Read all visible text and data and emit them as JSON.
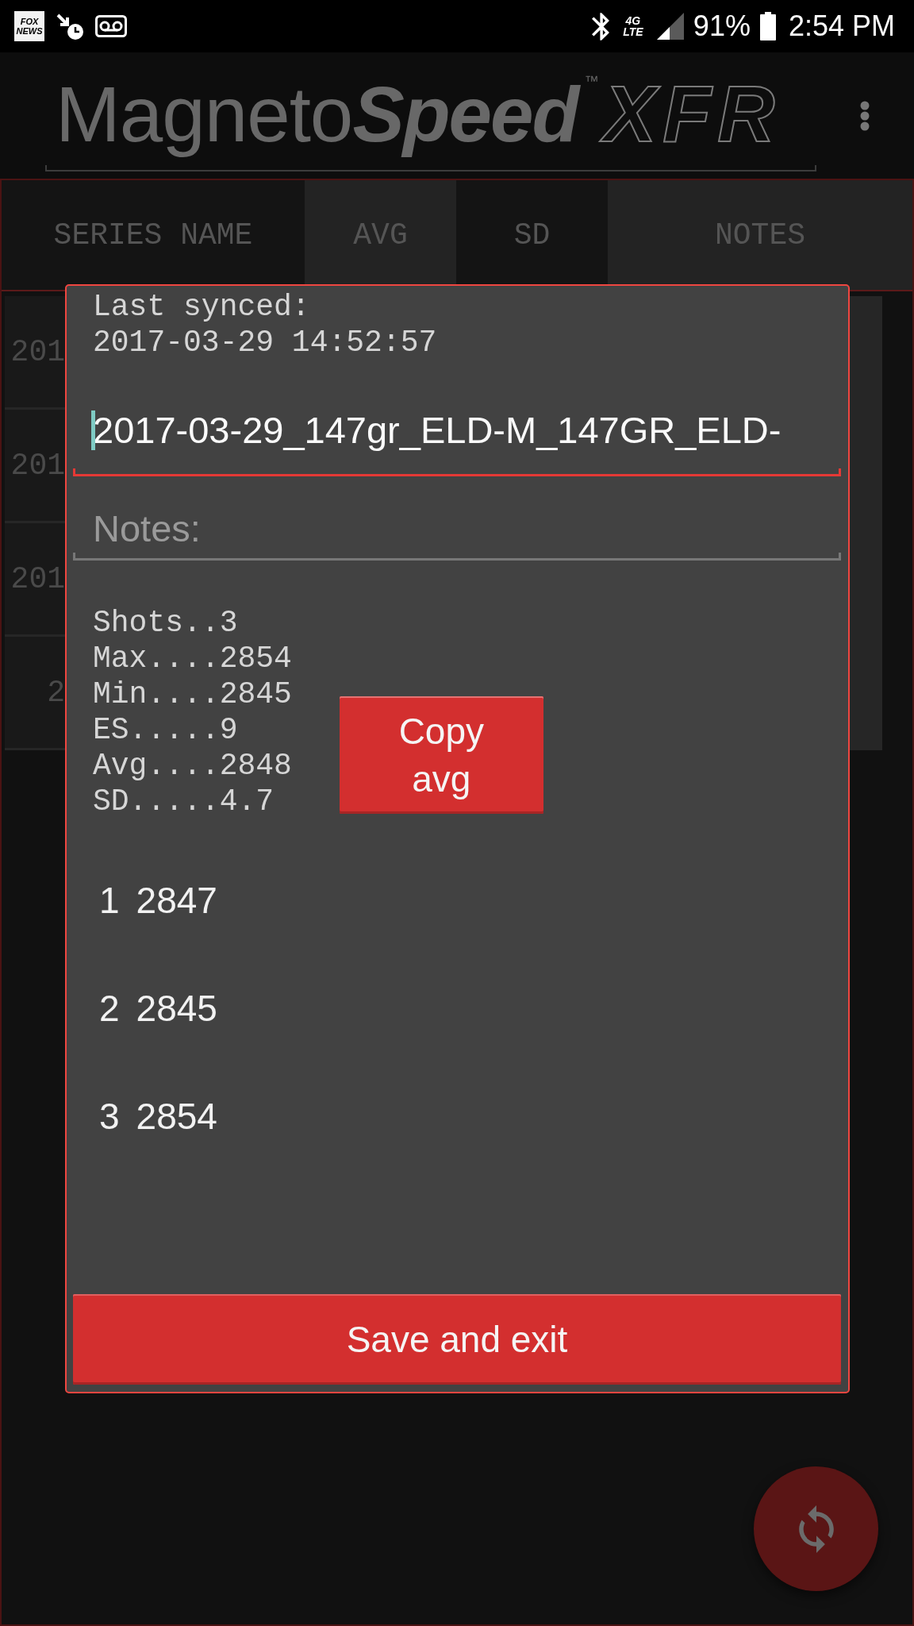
{
  "status_bar": {
    "news_badge": "FOX NEWS",
    "network": "4G LTE",
    "battery": "91%",
    "time": "2:54 PM"
  },
  "app_bar": {
    "logo": {
      "word_1": "Magneto",
      "word_2": "Speed",
      "trademark": "™",
      "badge": "XFR"
    }
  },
  "table": {
    "columns": [
      "SERIES NAME",
      "AVG",
      "SD",
      "NOTES"
    ],
    "rows": [
      {
        "series_name": "201"
      },
      {
        "series_name": "201"
      },
      {
        "series_name": "201"
      },
      {
        "series_name": "2"
      }
    ]
  },
  "dialog": {
    "last_synced": [
      "Last synced:",
      "2017-03-29 14:52:57"
    ],
    "name_field": {
      "value": "2017-03-29_147gr_ELD-M_147GR_ELD-",
      "focused": true
    },
    "notes_field": {
      "placeholder": "Notes:",
      "focused": false
    },
    "stats": [
      "Shots..3",
      "Max....2854",
      "Min....2845",
      "ES.....9",
      "Avg....2848",
      "SD.....4.7"
    ],
    "copy_button": "Copy avg",
    "shots": [
      {
        "number": "1",
        "velocity": "2847"
      },
      {
        "number": "2",
        "velocity": "2845"
      },
      {
        "number": "3",
        "velocity": "2854"
      }
    ],
    "save_button": "Save and exit"
  }
}
